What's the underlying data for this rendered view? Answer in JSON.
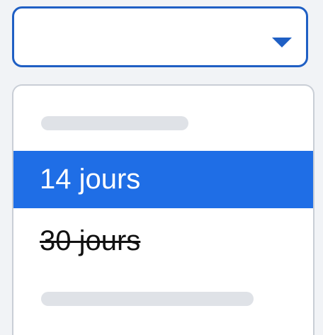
{
  "select": {
    "value": "",
    "caret_icon": "triangle-down-icon",
    "accent_color": "#1f5fc4"
  },
  "dropdown": {
    "options": [
      {
        "label": "14 jours",
        "state": "selected"
      },
      {
        "label": "30 jours",
        "state": "disabled-strikethrough"
      }
    ],
    "selected_bg_color": "#1f6ee6"
  }
}
